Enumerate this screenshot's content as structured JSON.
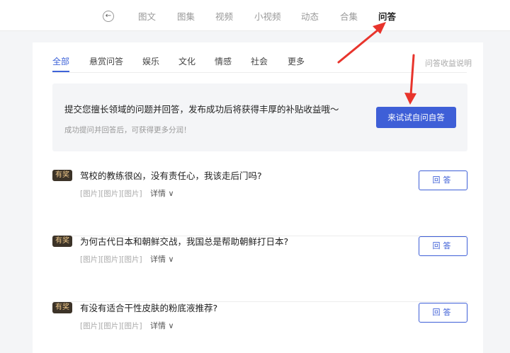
{
  "nav": {
    "back_icon": "back-circle-icon",
    "items": [
      {
        "label": "图文",
        "active": false
      },
      {
        "label": "图集",
        "active": false
      },
      {
        "label": "视频",
        "active": false
      },
      {
        "label": "小视频",
        "active": false
      },
      {
        "label": "动态",
        "active": false
      },
      {
        "label": "合集",
        "active": false
      },
      {
        "label": "问答",
        "active": true
      }
    ]
  },
  "tabs": {
    "items": [
      {
        "label": "全部",
        "active": true
      },
      {
        "label": "悬赏问答",
        "active": false
      },
      {
        "label": "娱乐",
        "active": false
      },
      {
        "label": "文化",
        "active": false
      },
      {
        "label": "情感",
        "active": false
      },
      {
        "label": "社会",
        "active": false
      },
      {
        "label": "更多",
        "active": false
      }
    ],
    "right_link": "问答收益说明"
  },
  "banner": {
    "title": "提交您擅长领域的问题并回答，发布成功后将获得丰厚的补贴收益哦～",
    "subtitle": "成功提问并回答后，可获得更多分润！",
    "button": "来试试自问自答"
  },
  "questions": [
    {
      "badge": "有奖",
      "title": "驾校的教练很凶，没有责任心，我该走后门吗?",
      "meta": "[图片][图片][图片]",
      "detail": "详情",
      "answer": "回答"
    },
    {
      "badge": "有奖",
      "title": "为何古代日本和朝鲜交战，我国总是帮助朝鲜打日本?",
      "meta": "[图片][图片][图片]",
      "detail": "详情",
      "answer": "回答"
    },
    {
      "badge": "有奖",
      "title": "有没有适合干性皮肤的粉底液推荐?",
      "meta": "[图片][图片][图片]",
      "detail": "详情",
      "answer": "回答"
    }
  ],
  "colors": {
    "accent": "#3e5fd7",
    "annotation": "#e8342c",
    "badge_bg": "#3c3328",
    "badge_text": "#f0c98b"
  }
}
